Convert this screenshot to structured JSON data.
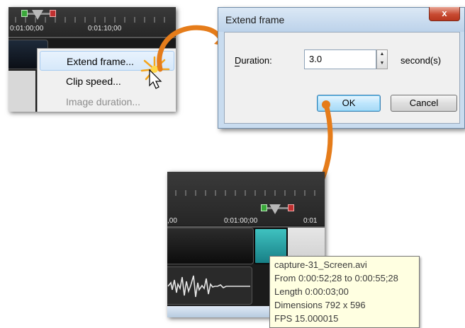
{
  "panel1": {
    "timecodes": [
      "0:01:00;00",
      "0:01:10;00"
    ],
    "context_menu": {
      "items": [
        {
          "label": "Extend frame...",
          "state": "highlighted"
        },
        {
          "label": "Clip speed...",
          "state": "normal"
        },
        {
          "label": "Image duration...",
          "state": "disabled"
        }
      ]
    }
  },
  "dialog": {
    "title": "Extend frame",
    "close_glyph": "x",
    "duration_label": "Duration:",
    "duration_value": "3.0",
    "unit_label": "second(s)",
    "ok_label": "OK",
    "cancel_label": "Cancel"
  },
  "panel3": {
    "timecodes": [
      ",00",
      "0:01:00;00",
      "0:01"
    ],
    "tooltip": {
      "lines": [
        "capture-31_Screen.avi",
        "From 0:00:52;28 to 0:00:55;28",
        "Length 0:00:03;00",
        "Dimensions 792 x 596",
        "FPS 15.000015"
      ]
    }
  },
  "colors": {
    "arrow": "#e57c1a",
    "clip_teal": "#2aa9ab",
    "marker_green": "#3aa83a",
    "marker_red": "#c03030",
    "tooltip_bg": "#ffffe1"
  }
}
